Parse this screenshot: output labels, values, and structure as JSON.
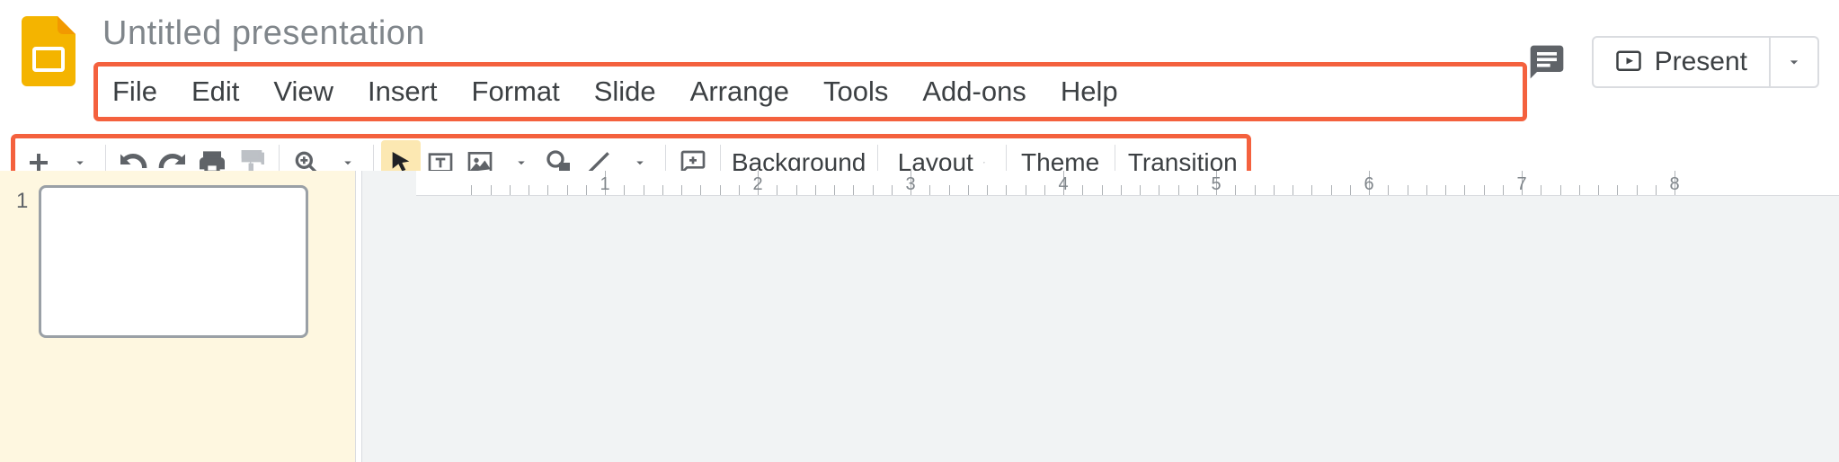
{
  "doc": {
    "title": "Untitled presentation"
  },
  "menubar": {
    "items": [
      "File",
      "Edit",
      "View",
      "Insert",
      "Format",
      "Slide",
      "Arrange",
      "Tools",
      "Add-ons",
      "Help"
    ]
  },
  "header": {
    "present_label": "Present"
  },
  "toolbar": {
    "text_buttons": {
      "background": "Background",
      "layout": "Layout",
      "theme": "Theme",
      "transition": "Transition"
    }
  },
  "slides": {
    "items": [
      {
        "index": "1"
      }
    ],
    "selected": 0
  },
  "ruler": {
    "labels": [
      "1",
      "2",
      "3",
      "4",
      "5",
      "6",
      "7",
      "8"
    ]
  },
  "highlight_color": "#f4613e"
}
